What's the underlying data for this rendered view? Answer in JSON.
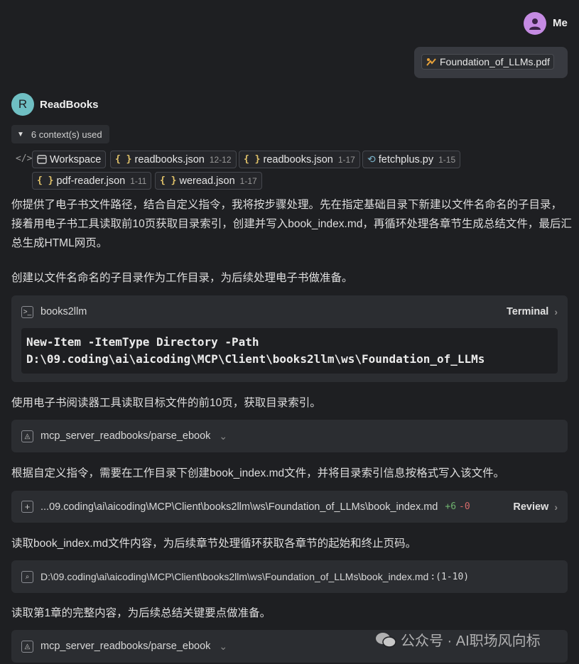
{
  "user": {
    "name": "Me",
    "attachment": "Foundation_of_LLMs.pdf"
  },
  "assistant": {
    "name": "ReadBooks",
    "avatar_letter": "R",
    "contexts_label": "6 context(s) used",
    "contexts": [
      {
        "icon": "workspace-icon",
        "name": "Workspace",
        "range": ""
      },
      {
        "icon": "json-icon",
        "name": "readbooks.json",
        "range": "12-12"
      },
      {
        "icon": "json-icon",
        "name": "readbooks.json",
        "range": "1-17"
      },
      {
        "icon": "python-icon",
        "name": "fetchplus.py",
        "range": "1-15"
      },
      {
        "icon": "json-icon",
        "name": "pdf-reader.json",
        "range": "1-11"
      },
      {
        "icon": "json-icon",
        "name": "weread.json",
        "range": "1-17"
      }
    ]
  },
  "messages": {
    "intro": "你提供了电子书文件路径，结合自定义指令，我将按步骤处理。先在指定基础目录下新建以文件名命名的子目录，接着用电子书工具读取前10页获取目录索引，创建并写入book_index.md，再循环处理各章节生成总结文件，最后汇总生成HTML网页。",
    "step1": "创建以文件名命名的子目录作为工作目录，为后续处理电子书做准备。",
    "step2": "使用电子书阅读器工具读取目标文件的前10页，获取目录索引。",
    "step3": "根据自定义指令，需要在工作目录下创建book_index.md文件，并将目录索引信息按格式写入该文件。",
    "step4": "读取book_index.md文件内容，为后续章节处理循环获取各章节的起始和终止页码。",
    "step5": "读取第1章的完整内容，为后续总结关键要点做准备。"
  },
  "terminal": {
    "cwd": "books2llm",
    "action": "Terminal",
    "command_line1": "New-Item -ItemType Directory -Path",
    "command_line2": "D:\\09.coding\\ai\\aicoding\\MCP\\Client\\books2llm\\ws\\Foundation_of_LLMs"
  },
  "tool1": {
    "label": "mcp_server_readbooks/parse_ebook"
  },
  "edit": {
    "path": "...09.coding\\ai\\aicoding\\MCP\\Client\\books2llm\\ws\\Foundation_of_LLMs\\book_index.md",
    "added": "+6",
    "removed": "-0",
    "action": "Review"
  },
  "read": {
    "path": "D:\\09.coding\\ai\\aicoding\\MCP\\Client\\books2llm\\ws\\Foundation_of_LLMs\\book_index.md",
    "range": ":(1-10)"
  },
  "tool2": {
    "label": "mcp_server_readbooks/parse_ebook"
  },
  "watermark": {
    "text": "公众号 · AI职场风向标"
  },
  "colors": {
    "background": "#1e1f22",
    "card": "#2b2d31",
    "user_avatar": "#c58be3",
    "bot_avatar": "#6fbfc3",
    "added": "#6fb36f",
    "removed": "#d46a6a",
    "json_icon": "#e3c46a"
  }
}
